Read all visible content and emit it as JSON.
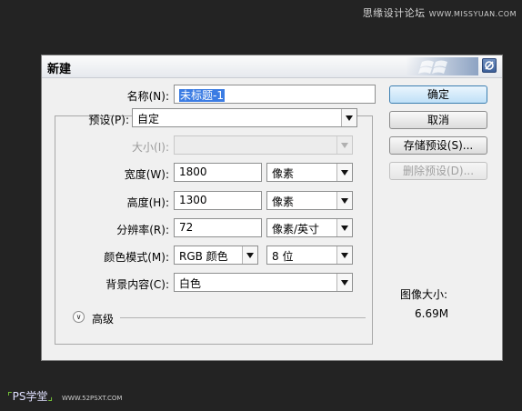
{
  "watermark_top": {
    "text": "思缘设计论坛",
    "url": "WWW.MISSYUAN.COM"
  },
  "watermark_bottom": {
    "brand": "PS学堂",
    "url": "WWW.52PSXT.COM"
  },
  "dialog": {
    "title": "新建",
    "fields": {
      "name": {
        "label": "名称(N):",
        "value": "未标题-1"
      },
      "preset": {
        "label": "预设(P):",
        "value": "自定"
      },
      "size": {
        "label": "大小(I):",
        "value": ""
      },
      "width": {
        "label": "宽度(W):",
        "value": "1800",
        "unit": "像素"
      },
      "height": {
        "label": "高度(H):",
        "value": "1300",
        "unit": "像素"
      },
      "resolution": {
        "label": "分辨率(R):",
        "value": "72",
        "unit": "像素/英寸"
      },
      "color_mode": {
        "label": "颜色模式(M):",
        "value": "RGB 颜色",
        "depth": "8 位"
      },
      "background": {
        "label": "背景内容(C):",
        "value": "白色"
      }
    },
    "advanced_label": "高级",
    "buttons": {
      "ok": "确定",
      "cancel": "取消",
      "save_preset": "存储预设(S)...",
      "delete_preset": "删除预设(D)..."
    },
    "image_size": {
      "title": "图像大小:",
      "value": "6.69M"
    }
  }
}
